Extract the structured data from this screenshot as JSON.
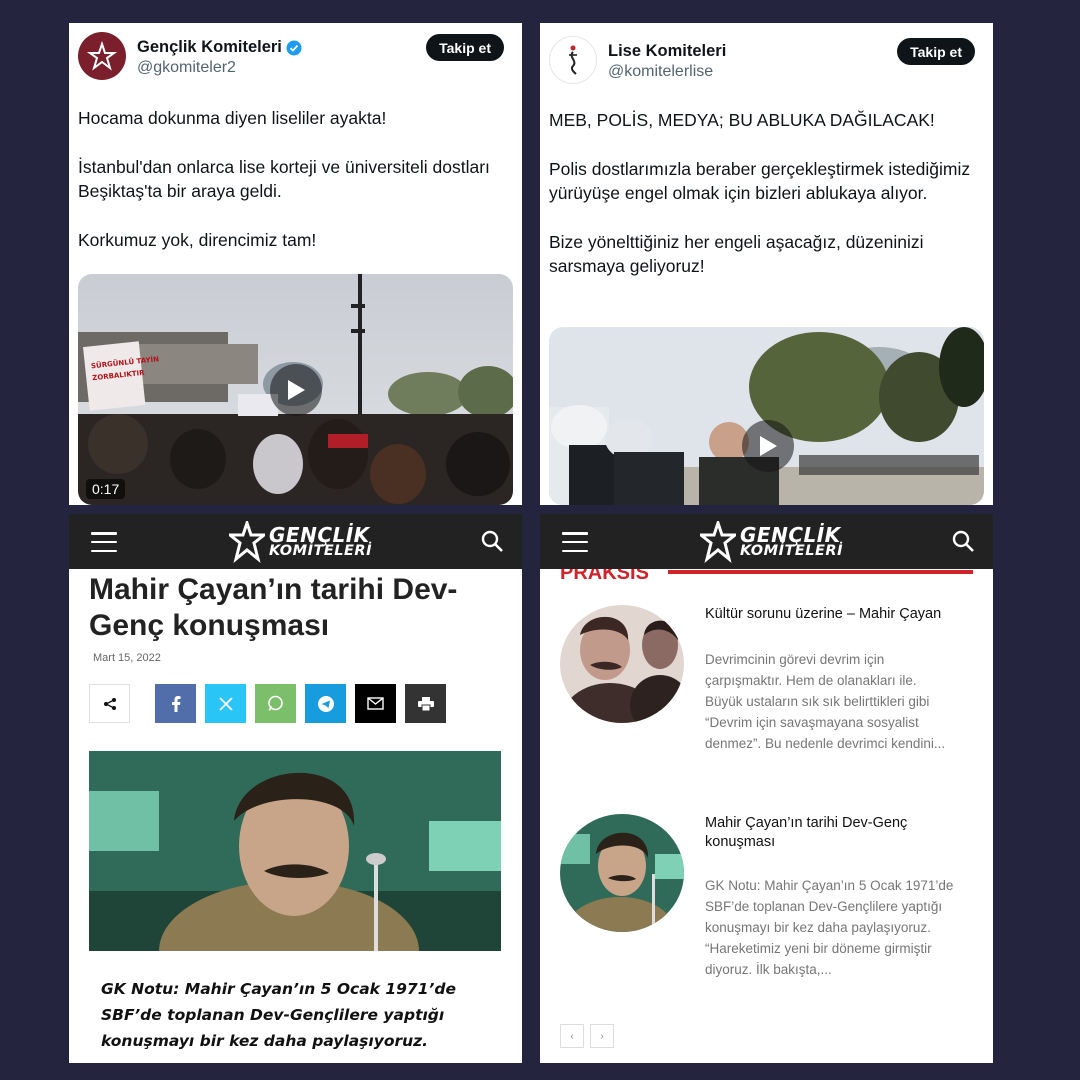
{
  "tweets": [
    {
      "name": "Gençlik Komiteleri",
      "handle": "@gkomiteler2",
      "follow_label": "Takip et",
      "verified": true,
      "paragraphs": [
        "Hocama dokunma diyen liseliler ayakta!",
        "İstanbul'dan onlarca lise korteji ve üniversiteli dostları Beşiktaş'ta bir araya geldi.",
        "Korkumuz yok, direncimiz tam!"
      ],
      "video_duration": "0:17",
      "banner_text": "SÜRGÜNLÜ TAYİN ZORBALIKTIR"
    },
    {
      "name": "Lise Komiteleri",
      "handle": "@komitelerlise",
      "follow_label": "Takip et",
      "verified": false,
      "paragraphs": [
        "MEB, POLİS, MEDYA; BU ABLUKA DAĞILACAK!",
        "Polis dostlarımızla beraber gerçekleştirmek istediğimiz yürüyüşe engel olmak için bizleri ablukaya alıyor.",
        "Bize yönelttiğiniz her engeli aşacağız, düzeninizi sarsmaya geliyoruz!"
      ]
    }
  ],
  "site": {
    "logo_line1": "GENÇLİK",
    "logo_line2": "KOMİTELERİ"
  },
  "article": {
    "title": "Mahir Çayan’ın tarihi Dev-Genç konuşması",
    "date": "Mart 15, 2022",
    "note": "GK Notu: Mahir Çayan’ın 5 Ocak 1971’de SBF’de toplanan Dev-Gençlilere yaptığı konuşmayı bir kez daha paylaşıyoruz.",
    "share_buttons": [
      {
        "icon": "share-icon",
        "color": "#ffffff"
      },
      {
        "icon": "facebook-icon",
        "color": "#516eab"
      },
      {
        "icon": "x-icon",
        "color": "#29c5f6"
      },
      {
        "icon": "whatsapp-icon",
        "color": "#7bbf6a"
      },
      {
        "icon": "telegram-icon",
        "color": "#179cde"
      },
      {
        "icon": "mail-icon",
        "color": "#000000"
      },
      {
        "icon": "print-icon",
        "color": "#333333"
      }
    ]
  },
  "sidebar": {
    "section_title": "PRAKSİS",
    "posts": [
      {
        "title": "Kültür sorunu üzerine – Mahir Çayan",
        "excerpt": "Devrimcinin görevi devrim için çarpışmaktır. Hem de olanakları ile. Büyük ustaların sık sık belirttikleri gibi “Devrim için savaşmayana sosyalist denmez”. Bu nedenle devrimci kendini..."
      },
      {
        "title": "Mahir Çayan’ın tarihi Dev-Genç konuşması",
        "excerpt": "GK Notu: Mahir Çayan’ın 5 Ocak 1971’de SBF’de toplanan Dev-Gençlilere yaptığı konuşmayı bir kez daha paylaşıyoruz. “Hareketimiz yeni bir döneme girmiştir diyoruz. İlk bakışta,..."
      }
    ],
    "pager_prev": "‹",
    "pager_next": "›"
  },
  "colors": {
    "background": "#24243e",
    "accent_red": "#d2222a",
    "gk_avatar": "#7a1f2b",
    "verified_blue": "#1d9bf0"
  }
}
